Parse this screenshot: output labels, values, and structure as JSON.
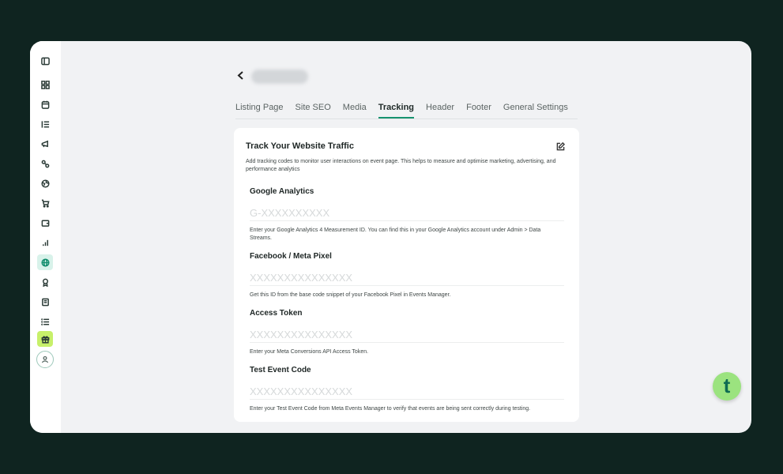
{
  "sidebar": {
    "items": [
      {
        "icon": "sidebar-toggle-icon"
      },
      {
        "icon": "dashboard-grid-icon"
      },
      {
        "icon": "calendar-icon"
      },
      {
        "icon": "list-ordered-icon"
      },
      {
        "icon": "megaphone-icon"
      },
      {
        "icon": "phone-icon"
      },
      {
        "icon": "globe-icon"
      },
      {
        "icon": "cart-icon"
      },
      {
        "icon": "wallet-icon"
      },
      {
        "icon": "bar-chart-icon"
      },
      {
        "icon": "website-globe-icon",
        "active": true
      },
      {
        "icon": "badge-icon"
      },
      {
        "icon": "book-icon"
      },
      {
        "icon": "menu-list-icon"
      },
      {
        "icon": "gift-icon"
      }
    ],
    "accent_color": "#d8f2ea",
    "gift_color": "#c7f06a"
  },
  "header": {
    "back_icon": "chevron-left-icon"
  },
  "tabs": [
    {
      "label": "Listing Page"
    },
    {
      "label": "Site SEO"
    },
    {
      "label": "Media"
    },
    {
      "label": "Tracking",
      "active": true
    },
    {
      "label": "Header"
    },
    {
      "label": "Footer"
    },
    {
      "label": "General Settings"
    }
  ],
  "card": {
    "title": "Track Your Website Traffic",
    "description": "Add tracking codes to monitor user interactions on event page. This helps to measure and optimise marketing, advertising, and performance analytics",
    "edit_icon": "edit-icon",
    "fields": [
      {
        "label": "Google Analytics",
        "placeholder": "G-XXXXXXXXXX",
        "help": "Enter your Google Analytics 4 Measurement ID. You can find this in your Google Analytics account under Admin > Data Streams."
      },
      {
        "label": "Facebook / Meta Pixel",
        "placeholder": "XXXXXXXXXXXXXXX",
        "help": "Get this ID from the base code snippet of your Facebook Pixel in Events Manager."
      },
      {
        "label": "Access Token",
        "placeholder": "XXXXXXXXXXXXXXX",
        "help": "Enter your Meta Conversions API Access Token."
      },
      {
        "label": "Test Event Code",
        "placeholder": "XXXXXXXXXXXXXXX",
        "help": "Enter your Test Event Code from Meta Events Manager to verify that events are being sent correctly during testing."
      }
    ]
  },
  "brand": {
    "logo_letter": "t",
    "color": "#9be37f",
    "accent": "#17936f"
  }
}
